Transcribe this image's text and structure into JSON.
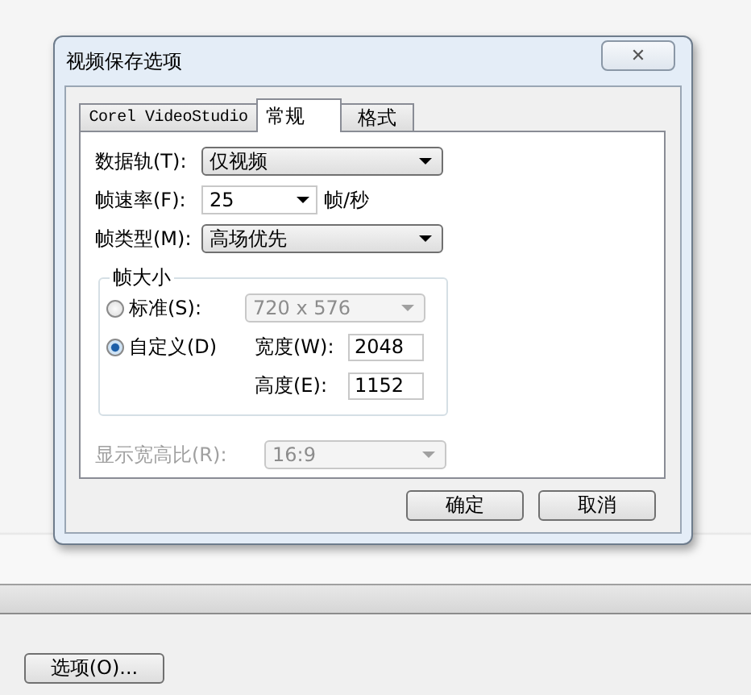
{
  "dialog": {
    "title": "视频保存选项",
    "close": "✕",
    "tabs": [
      {
        "label": "Corel VideoStudio",
        "selected": false
      },
      {
        "label": "常规",
        "selected": true
      },
      {
        "label": "格式",
        "selected": false
      }
    ],
    "rows": [
      {
        "label": "数据轨(T):",
        "value": "仅视频",
        "kind": "dropdown"
      },
      {
        "label": "帧速率(F):",
        "value": "25",
        "kind": "combo",
        "unit": "帧/秒"
      },
      {
        "label": "帧类型(M):",
        "value": "高场优先",
        "kind": "dropdown"
      }
    ],
    "frame_size": {
      "title": "帧大小",
      "options": [
        {
          "label": "标准(S):",
          "selected": false,
          "value": "720 x 576",
          "disabled": true
        },
        {
          "label": "自定义(D)",
          "selected": true
        }
      ],
      "width": {
        "label": "宽度(W):",
        "value": "2048"
      },
      "height": {
        "label": "高度(E):",
        "value": "1152"
      }
    },
    "aspect": {
      "label": "显示宽高比(R):",
      "value": "16:9",
      "disabled": true
    },
    "buttons": [
      "确定",
      "取消"
    ]
  },
  "background": {
    "button": "选项(O)..."
  }
}
